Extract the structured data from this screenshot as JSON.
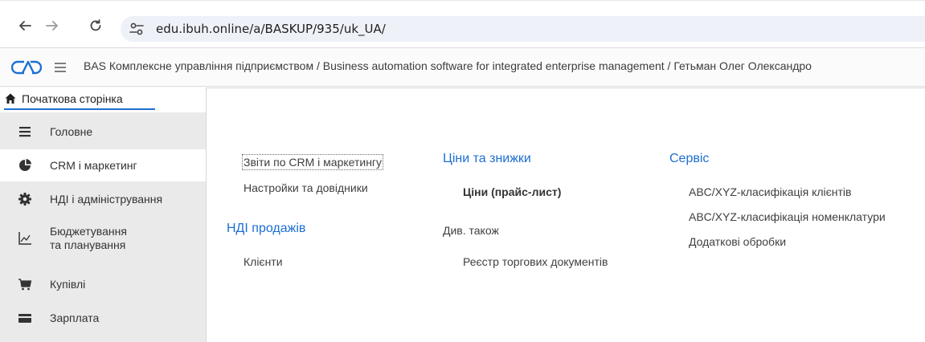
{
  "browser": {
    "url": "edu.ibuh.online/a/BASKUP/935/uk_UA/"
  },
  "app": {
    "title": "BAS Комплексне управління підприємством / Business automation software for integrated enterprise management / Гетьман Олег Олександро"
  },
  "home_tab": {
    "label": "Початкова сторінка"
  },
  "sidebar": {
    "items": [
      {
        "label": "Головне",
        "icon": "list-icon"
      },
      {
        "label": "CRM і маркетинг",
        "icon": "pie-chart-icon"
      },
      {
        "label": "НДІ і адміністрування",
        "icon": "gear-icon"
      },
      {
        "label_line1": "Бюджетування",
        "label_line2": "та планування",
        "icon": "chart-axes-icon"
      },
      {
        "label": "Купівлі",
        "icon": "cart-icon"
      },
      {
        "label": "Зарплата",
        "icon": "wallet-icon"
      }
    ]
  },
  "content": {
    "col1": {
      "links": [
        "Звіти по CRM і маркетингу",
        "Настройки та довідники"
      ],
      "group_title": "НДІ продажів",
      "group_links": [
        "Клієнти"
      ]
    },
    "col2": {
      "group_title": "Ціни та знижки",
      "links": [
        "Ціни (прайс-лист)"
      ],
      "see_also_label": "Див. також",
      "see_also_links": [
        "Реєстр торгових документів"
      ]
    },
    "col3": {
      "group_title": "Сервіс",
      "links": [
        "ABC/XYZ-класифікація клієнтів",
        "ABC/XYZ-класифікація номенклатури",
        "Додаткові обробки"
      ]
    }
  },
  "colors": {
    "accent": "#1c6fd1",
    "sidebar_bg": "#eaeaea",
    "url_bg": "#eef1f8"
  }
}
